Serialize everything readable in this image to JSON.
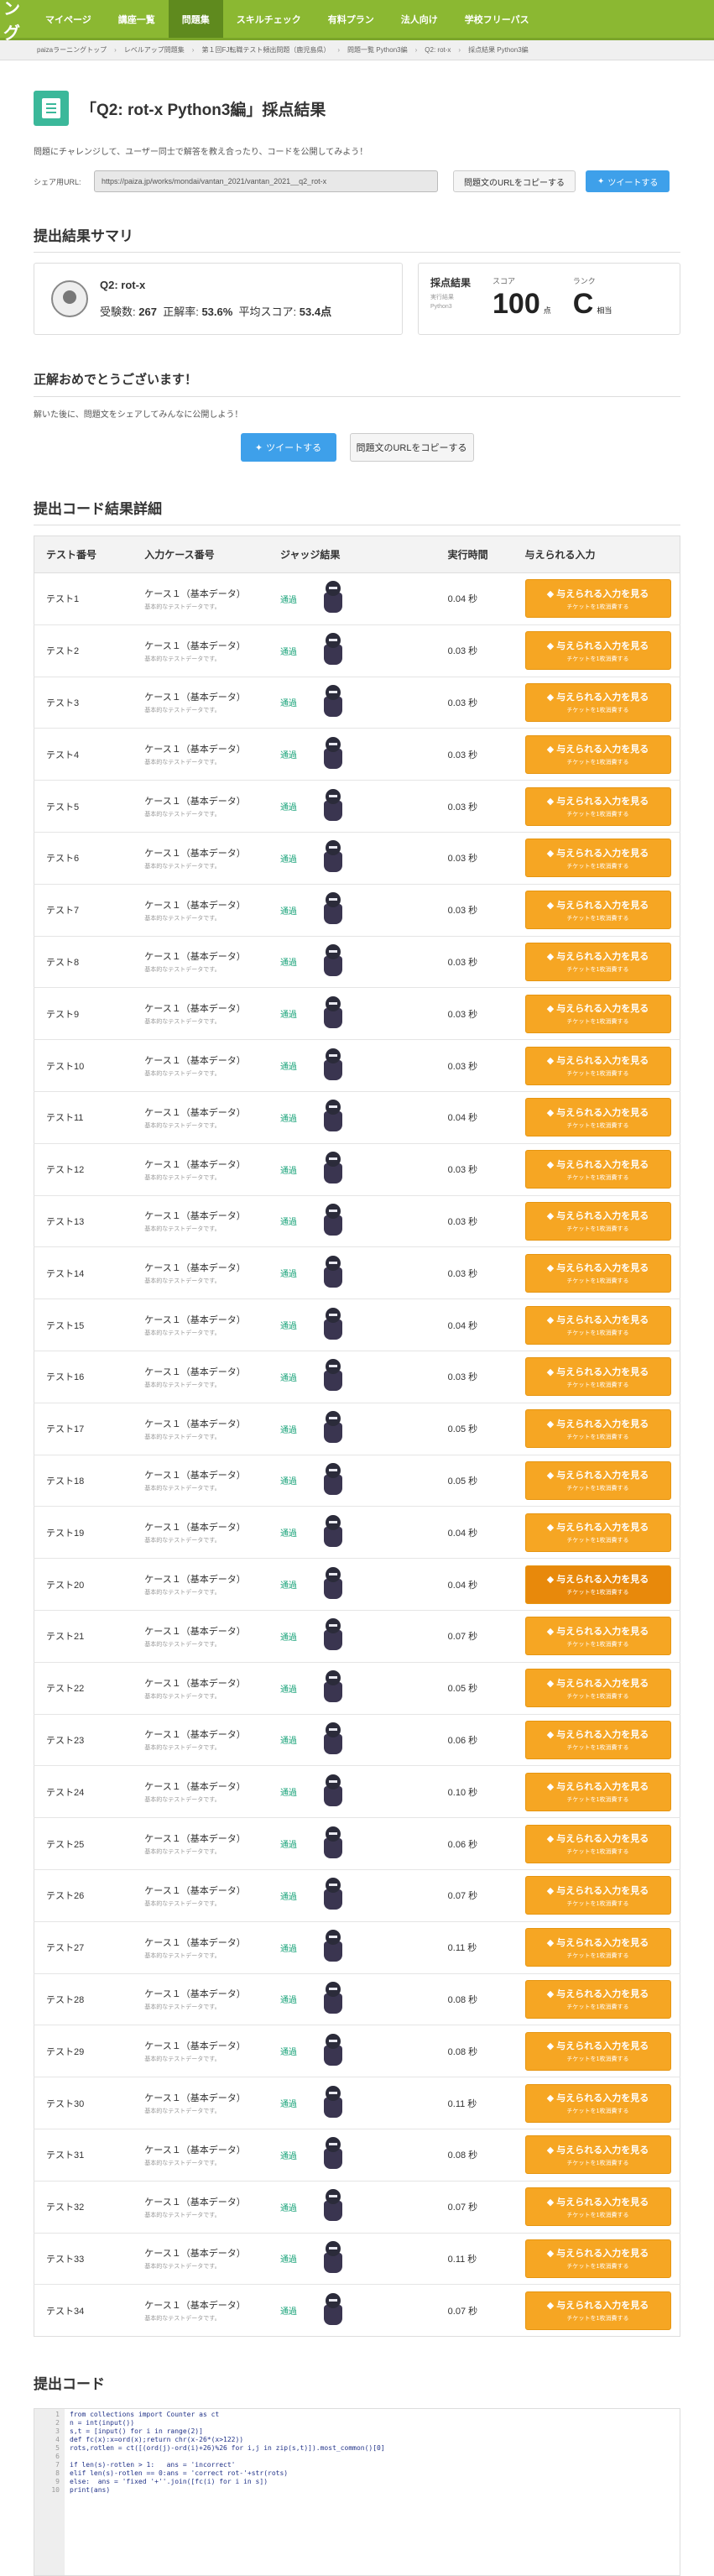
{
  "nav": {
    "logo_fragment": "ング",
    "items": [
      {
        "label": "マイページ",
        "active": false
      },
      {
        "label": "講座一覧",
        "active": false
      },
      {
        "label": "問題集",
        "active": true
      },
      {
        "label": "スキルチェック",
        "active": false
      },
      {
        "label": "有料プラン",
        "active": false
      },
      {
        "label": "法人向け",
        "active": false
      },
      {
        "label": "学校フリーパス",
        "active": false
      }
    ]
  },
  "breadcrumb": [
    "paizaラーニングトップ",
    "レベルアップ問題集",
    "第１回FJ転職テスト頻出問題（鹿児島県）",
    "問題一覧 Python3編",
    "Q2: rot-x",
    "採点結果 Python3編"
  ],
  "header": {
    "title": "「Q2: rot-x Python3編」採点結果",
    "intro": "問題にチャレンジして、ユーザー同士で解答を教え合ったり、コードを公開してみよう！",
    "share_label": "シェア用URL:",
    "share_url": "https://paiza.jp/works/mondai/vantan_2021/vantan_2021__q2_rot-x",
    "copy_label": "問題文のURLをコピーする",
    "tweet_label": "ツイートする"
  },
  "summary": {
    "heading": "提出結果サマリ",
    "problem_name": "Q2: rot-x",
    "stats_label1": "受験数:",
    "submissions": "267",
    "stats_label2": "正解率:",
    "accuracy": "53.6%",
    "stats_label3": "平均スコア:",
    "avg_score": "53.4点",
    "result_label": "採点結果",
    "result_sub1": "実行結果",
    "result_sub2": "Python3",
    "score_caption": "スコア",
    "score": "100",
    "score_unit": "点",
    "rank_caption": "ランク",
    "rank": "C",
    "rank_unit": "相当"
  },
  "congrats": {
    "title": "正解おめでとうございます！",
    "message": "解いた後に、問題文をシェアしてみんなに公開しよう！",
    "tweet_label": "ツイートする",
    "copy_label": "問題文のURLをコピーする"
  },
  "results": {
    "heading": "提出コード結果詳細",
    "columns": [
      "テスト番号",
      "入力ケース番号",
      "ジャッジ結果",
      "実行時間",
      "与えられる入力"
    ],
    "case_label": "ケース１（基本データ）",
    "case_sub": "基本的なテストデータです。",
    "judge_label": "通過",
    "button_l1": "与えられる入力を見る",
    "button_l2": "チケットを1枚消費する",
    "rows": [
      {
        "test": "テスト1",
        "time": "0.04 秒"
      },
      {
        "test": "テスト2",
        "time": "0.03 秒"
      },
      {
        "test": "テスト3",
        "time": "0.03 秒"
      },
      {
        "test": "テスト4",
        "time": "0.03 秒"
      },
      {
        "test": "テスト5",
        "time": "0.03 秒"
      },
      {
        "test": "テスト6",
        "time": "0.03 秒"
      },
      {
        "test": "テスト7",
        "time": "0.03 秒"
      },
      {
        "test": "テスト8",
        "time": "0.03 秒"
      },
      {
        "test": "テスト9",
        "time": "0.03 秒"
      },
      {
        "test": "テスト10",
        "time": "0.03 秒"
      },
      {
        "test": "テスト11",
        "time": "0.04 秒"
      },
      {
        "test": "テスト12",
        "time": "0.03 秒"
      },
      {
        "test": "テスト13",
        "time": "0.03 秒"
      },
      {
        "test": "テスト14",
        "time": "0.03 秒"
      },
      {
        "test": "テスト15",
        "time": "0.04 秒"
      },
      {
        "test": "テスト16",
        "time": "0.03 秒"
      },
      {
        "test": "テスト17",
        "time": "0.05 秒"
      },
      {
        "test": "テスト18",
        "time": "0.05 秒"
      },
      {
        "test": "テスト19",
        "time": "0.04 秒"
      },
      {
        "test": "テスト20",
        "time": "0.04 秒",
        "active": true
      },
      {
        "test": "テスト21",
        "time": "0.07 秒"
      },
      {
        "test": "テスト22",
        "time": "0.05 秒"
      },
      {
        "test": "テスト23",
        "time": "0.06 秒"
      },
      {
        "test": "テスト24",
        "time": "0.10 秒"
      },
      {
        "test": "テスト25",
        "time": "0.06 秒"
      },
      {
        "test": "テスト26",
        "time": "0.07 秒"
      },
      {
        "test": "テスト27",
        "time": "0.11 秒"
      },
      {
        "test": "テスト28",
        "time": "0.08 秒"
      },
      {
        "test": "テスト29",
        "time": "0.08 秒"
      },
      {
        "test": "テスト30",
        "time": "0.11 秒"
      },
      {
        "test": "テスト31",
        "time": "0.08 秒"
      },
      {
        "test": "テスト32",
        "time": "0.07 秒"
      },
      {
        "test": "テスト33",
        "time": "0.11 秒"
      },
      {
        "test": "テスト34",
        "time": "0.07 秒"
      }
    ]
  },
  "code": {
    "heading": "提出コード",
    "lines": [
      "from collections import Counter as ct",
      "n = int(input())",
      "s,t = [input() for i in range(2)]",
      "def fc(x):x=ord(x);return chr(x-26*(x>122))",
      "rots,rotlen = ct([(ord(j)-ord(i)+26)%26 for i,j in zip(s,t)]).most_common()[0]",
      "",
      "if len(s)-rotlen > 1:   ans = 'incorrect'",
      "elif len(s)-rotlen == 0:ans = 'correct rot-'+str(rots)",
      "else:  ans = 'fixed '+''.join([fc(i) for i in s])",
      "print(ans)"
    ]
  },
  "colors": {
    "nav_bg": "#8bb832",
    "accent_orange": "#f6a623",
    "tweet_blue": "#3ea0ea",
    "pass_green": "#1aa37a"
  }
}
